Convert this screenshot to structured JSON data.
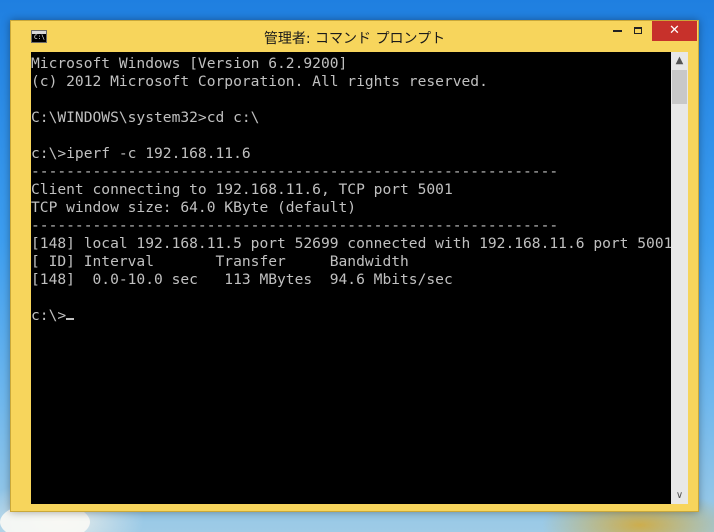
{
  "window": {
    "title": "管理者: コマンド プロンプト",
    "icon_label": "C:\\",
    "buttons": {
      "minimize_icon": "minimize-icon",
      "maximize_icon": "maximize-icon",
      "close_icon": "close-icon",
      "close_glyph": "✕"
    }
  },
  "console": {
    "lines": [
      "Microsoft Windows [Version 6.2.9200]",
      "(c) 2012 Microsoft Corporation. All rights reserved.",
      "",
      "C:\\WINDOWS\\system32>cd c:\\",
      "",
      "c:\\>iperf -c 192.168.11.6",
      "------------------------------------------------------------",
      "Client connecting to 192.168.11.6, TCP port 5001",
      "TCP window size: 64.0 KByte (default)",
      "------------------------------------------------------------",
      "[148] local 192.168.11.5 port 52699 connected with 192.168.11.6 port 5001",
      "[ ID] Interval       Transfer     Bandwidth",
      "[148]  0.0-10.0 sec   113 MBytes  94.6 Mbits/sec",
      "",
      "c:\\>"
    ]
  },
  "scrollbar": {
    "up_glyph": "▲",
    "down_glyph": "∨"
  },
  "colors": {
    "window_frame": "#f7d55c",
    "console_bg": "#000000",
    "console_text": "#c0c0c0",
    "close_button": "#c7312b"
  }
}
